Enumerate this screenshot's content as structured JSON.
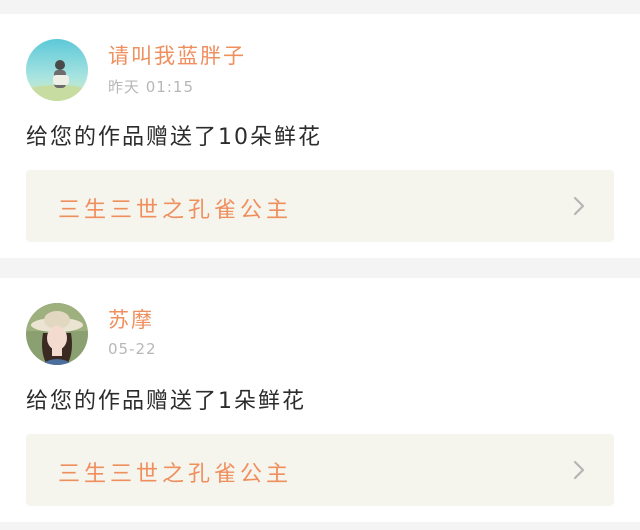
{
  "notifications": [
    {
      "username": "请叫我蓝胖子",
      "time": "昨天 01:15",
      "message": "给您的作品赠送了10朵鲜花",
      "work_title": "三生三世之孔雀公主",
      "avatar_icon": "user-photo-avatar"
    },
    {
      "username": "苏摩",
      "time": "05-22",
      "message": "给您的作品赠送了1朵鲜花",
      "work_title": "三生三世之孔雀公主",
      "avatar_icon": "user-photo-avatar"
    }
  ],
  "colors": {
    "accent": "#ef8f5e",
    "text": "#2c2c2c",
    "muted": "#b7b7b7",
    "link_bg": "#f5f5ee",
    "page_bg": "#f4f4f4"
  }
}
